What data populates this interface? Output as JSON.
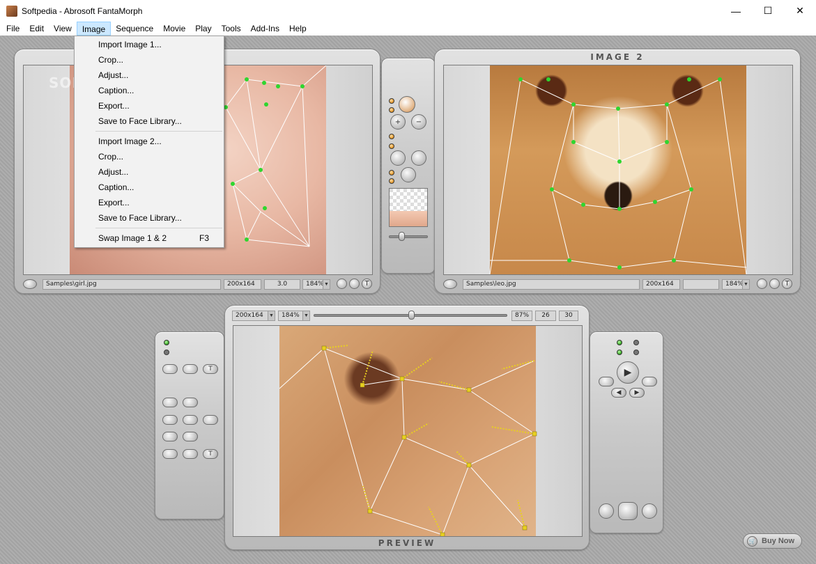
{
  "window": {
    "title": "Softpedia - Abrosoft FantaMorph",
    "controls": {
      "minimize": "—",
      "maximize": "☐",
      "close": "✕"
    }
  },
  "menubar": [
    "File",
    "Edit",
    "View",
    "Image",
    "Sequence",
    "Movie",
    "Play",
    "Tools",
    "Add-Ins",
    "Help"
  ],
  "watermark": "SOFTPEDIA",
  "image_menu": {
    "items": [
      "Import Image 1...",
      "Crop...",
      "Adjust...",
      "Caption...",
      "Export...",
      "Save to Face Library...",
      "Import Image 2...",
      "Crop...",
      "Adjust...",
      "Caption...",
      "Export...",
      "Save to Face Library...",
      "Swap Image 1 & 2"
    ],
    "swap_shortcut": "F3"
  },
  "image1": {
    "path": "Samples\\girl.jpg",
    "size": "200x164",
    "value": "3.0",
    "zoom": "184%"
  },
  "image2": {
    "title": "IMAGE 2",
    "path": "Samples\\leo.jpg",
    "size": "200x164",
    "zoom": "184%"
  },
  "preview": {
    "title": "PREVIEW",
    "size": "200x164",
    "zoom": "184%",
    "progress": "87%",
    "frame": "26",
    "total_frames": "30",
    "progress_fraction": 0.87
  },
  "buy_now": "Buy Now",
  "icons": {
    "arrow_sym": "↔",
    "plus": "+",
    "minus": "−",
    "text_tool": "T",
    "play": "▶",
    "prev": "◀",
    "next": "▶"
  },
  "colors": {
    "workspace_bg": "#a9a9a9",
    "mesh_line": "#ffffff",
    "mesh_point": "#2fd62f",
    "morph_point": "#e8d020",
    "menu_highlight": "#cce8ff"
  }
}
